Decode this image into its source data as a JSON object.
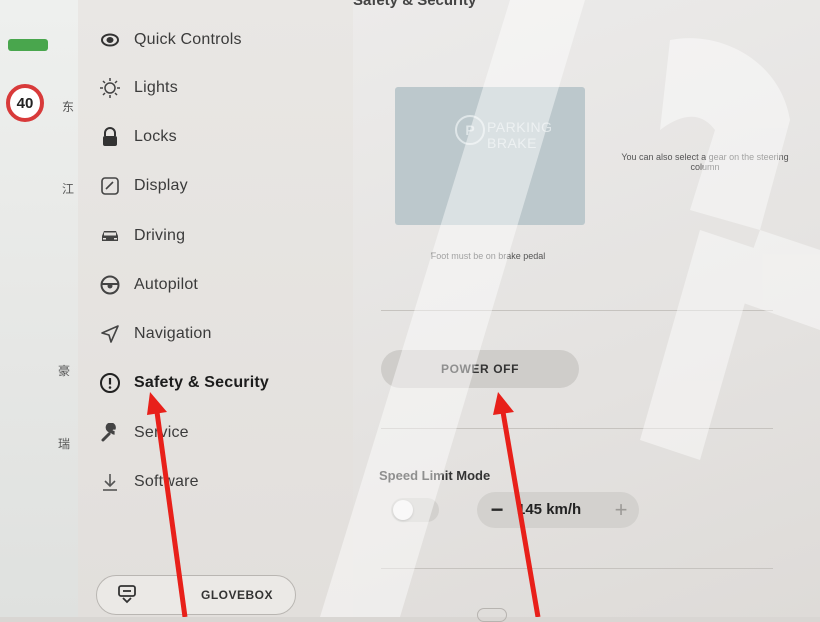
{
  "map": {
    "speed_limit": "40",
    "chars": [
      "东",
      "江",
      "豪",
      "瑞"
    ],
    "battery_color": "#49a64d"
  },
  "sidebar": {
    "items": [
      {
        "label": "Quick Controls",
        "icon": "car-eye-icon"
      },
      {
        "label": "Lights",
        "icon": "sun-light-icon"
      },
      {
        "label": "Locks",
        "icon": "lock-icon"
      },
      {
        "label": "Display",
        "icon": "display-icon"
      },
      {
        "label": "Driving",
        "icon": "car-icon"
      },
      {
        "label": "Autopilot",
        "icon": "steering-wheel-icon"
      },
      {
        "label": "Navigation",
        "icon": "navigation-arrow-icon"
      },
      {
        "label": "Safety & Security",
        "icon": "exclamation-circle-icon",
        "active": true
      },
      {
        "label": "Service",
        "icon": "wrench-icon"
      },
      {
        "label": "Software",
        "icon": "download-icon"
      }
    ],
    "glovebox_label": "GLOVEBOX"
  },
  "main": {
    "section_title": "Safety & Security",
    "parking_brake": {
      "icon_text": "P",
      "label": "PARKING BRAKE"
    },
    "gear_hint": "You can also select a gear on the steering column",
    "brake_hint": "Foot must be on brake pedal",
    "power_off_label": "POWER OFF",
    "speed_limit_label": "Speed Limit Mode",
    "speed_limit_value": "145 km/h",
    "speed_limit_enabled": false,
    "minus_label": "−",
    "plus_label": "+"
  },
  "colors": {
    "annotation_arrow": "#e8201a",
    "speed_sign_border": "#d83a3a"
  }
}
